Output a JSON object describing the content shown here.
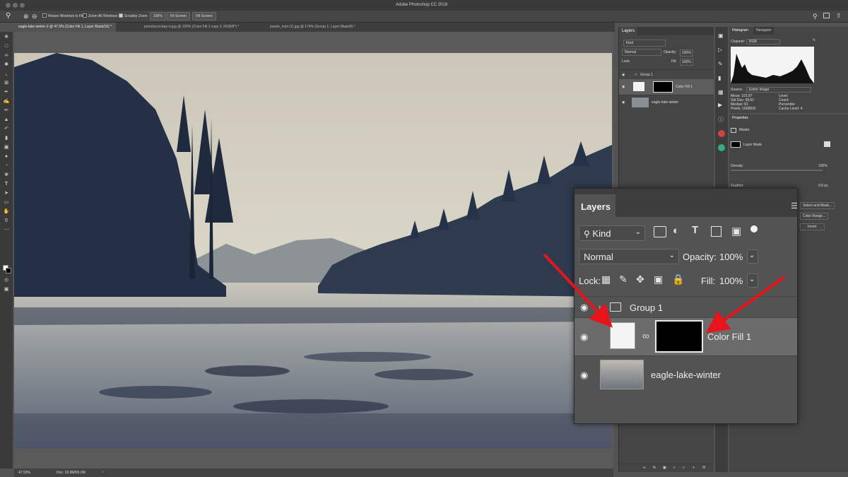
{
  "app": {
    "title": "Adobe Photoshop CC 2018"
  },
  "options_bar": {
    "resize_windows": "Resize Windows to Fit",
    "zoom_all": "Zoom All Windows",
    "scrubby_zoom": "Scrubby Zoom",
    "zoom_pct": "100%",
    "fit_screen": "Fit Screen",
    "fill_screen": "Fill Screen"
  },
  "tabs": [
    {
      "label": "eagle-lake-winter-2 @ 47.5% (Color Fill 1, Layer Mask/16) *"
    },
    {
      "label": "penobscot-bay-iv.jpg @ 100% (Color Fill 1 copy 3, RGB/8*) *"
    },
    {
      "label": "purple_mist (1).jpg @ 174% (Group 1, Layer Mask/8) *"
    }
  ],
  "status": {
    "zoom": "47.53%",
    "doc": "Doc: 32.9M/65.0M"
  },
  "small_layers": {
    "title": "Layers",
    "kind": "Kind",
    "blend": "Normal",
    "opacity_label": "Opacity:",
    "opacity": "100%",
    "lock_label": "Lock:",
    "fill_label": "Fill:",
    "fill": "100%",
    "layers": [
      {
        "name": "Group 1"
      },
      {
        "name": "Color Fill 1"
      },
      {
        "name": "eagle-lake-winter"
      }
    ]
  },
  "histogram": {
    "tab1": "Histogram",
    "tab2": "Navigator",
    "channel_label": "Channel:",
    "channel": "RGB",
    "source_label": "Source:",
    "source": "Entire Image",
    "stats_left": [
      "Mean: 101.87",
      "Std Dev: 68.62",
      "Median: 81",
      "Pixels: 1608832"
    ],
    "stats_right": [
      "Level:",
      "Count:",
      "Percentile:",
      "Cache Level: 4"
    ]
  },
  "properties": {
    "tab": "Properties",
    "masks_label": "Masks",
    "layer_mask": "Layer Mask",
    "density": "Density:",
    "density_val": "100%",
    "feather": "Feather:",
    "feather_val": "0.0 px",
    "select_mask": "Select and Mask...",
    "color_range": "Color Range...",
    "invert": "Invert"
  },
  "zoom_panel": {
    "title": "Layers",
    "kind": "Kind",
    "blend": "Normal",
    "opacity_label": "Opacity:",
    "opacity": "100%",
    "lock_label": "Lock:",
    "fill_label": "Fill:",
    "fill": "100%",
    "layers": [
      {
        "name": "Group 1"
      },
      {
        "name": "Color Fill 1"
      },
      {
        "name": "eagle-lake-winter"
      }
    ]
  },
  "icons": {
    "zoom": "magnifier-icon",
    "eye": "eye-icon",
    "folder": "folder-icon",
    "link": "chain-link-icon",
    "lock": "lock-icon"
  },
  "colors": {
    "accent_arrow": "#e8141c",
    "panel": "#535353",
    "chrome": "#3a3a3a"
  }
}
